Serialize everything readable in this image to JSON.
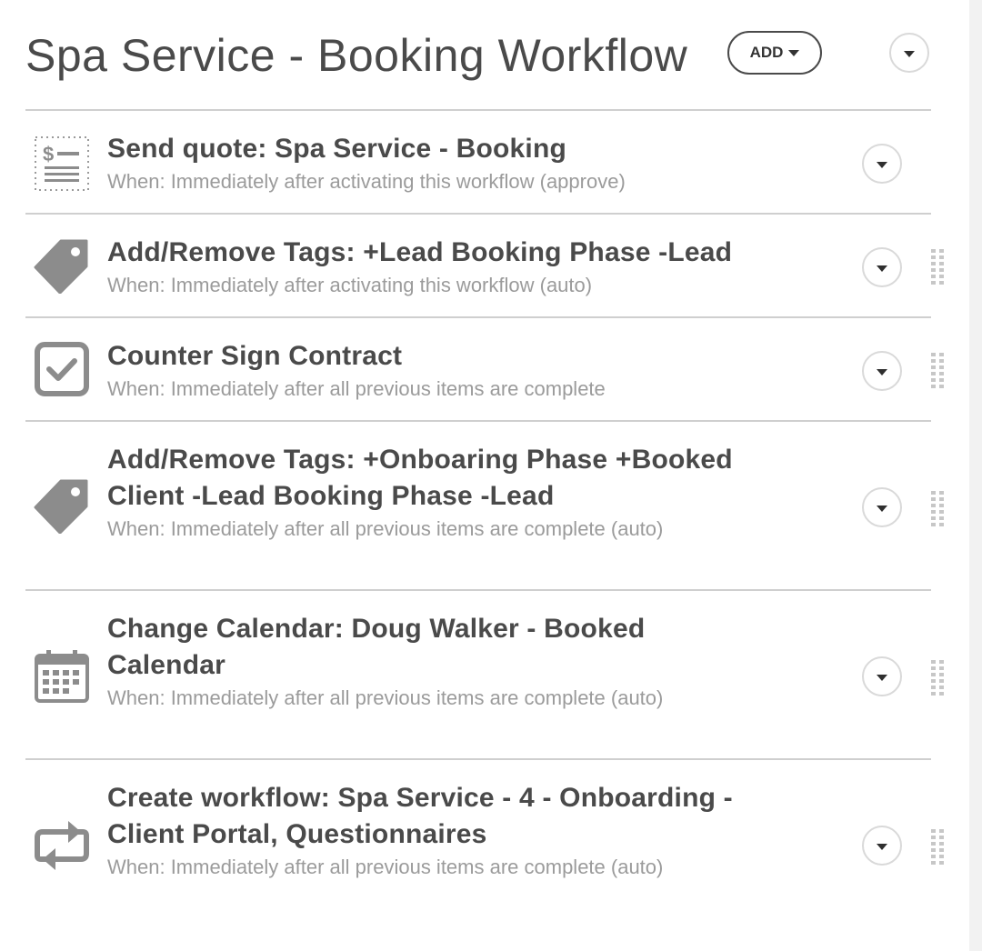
{
  "header": {
    "title": "Spa Service - Booking Workflow",
    "add_label": "ADD"
  },
  "items": [
    {
      "icon": "quote-document-icon",
      "title": "Send quote: Spa Service - Booking",
      "when": "When: Immediately after activating this workflow (approve)",
      "draggable": false
    },
    {
      "icon": "tag-icon",
      "title": "Add/Remove Tags: +Lead Booking Phase -Lead",
      "when": "When: Immediately after activating this workflow (auto)",
      "draggable": true
    },
    {
      "icon": "checkbox-icon",
      "title": "Counter Sign Contract",
      "when": "When: Immediately after all previous items are complete",
      "draggable": true
    },
    {
      "icon": "tag-icon",
      "title": "Add/Remove Tags: +Onboaring Phase +Booked Client -Lead Booking Phase -Lead",
      "when": "When: Immediately after all previous items are complete (auto)",
      "draggable": true
    },
    {
      "icon": "calendar-icon",
      "title": "Change Calendar: Doug Walker - Booked Calendar",
      "when": "When: Immediately after all previous items are complete (auto)",
      "draggable": true
    },
    {
      "icon": "repeat-workflow-icon",
      "title": "Create workflow: Spa Service - 4 - Onboarding - Client Portal, Questionnaires",
      "when": "When: Immediately after all previous items are complete (auto)",
      "draggable": true
    }
  ],
  "colors": {
    "text": "#4a4a4a",
    "muted": "#9b9b9b",
    "icon": "#8c8c8c",
    "divider": "#cfcfcf"
  }
}
